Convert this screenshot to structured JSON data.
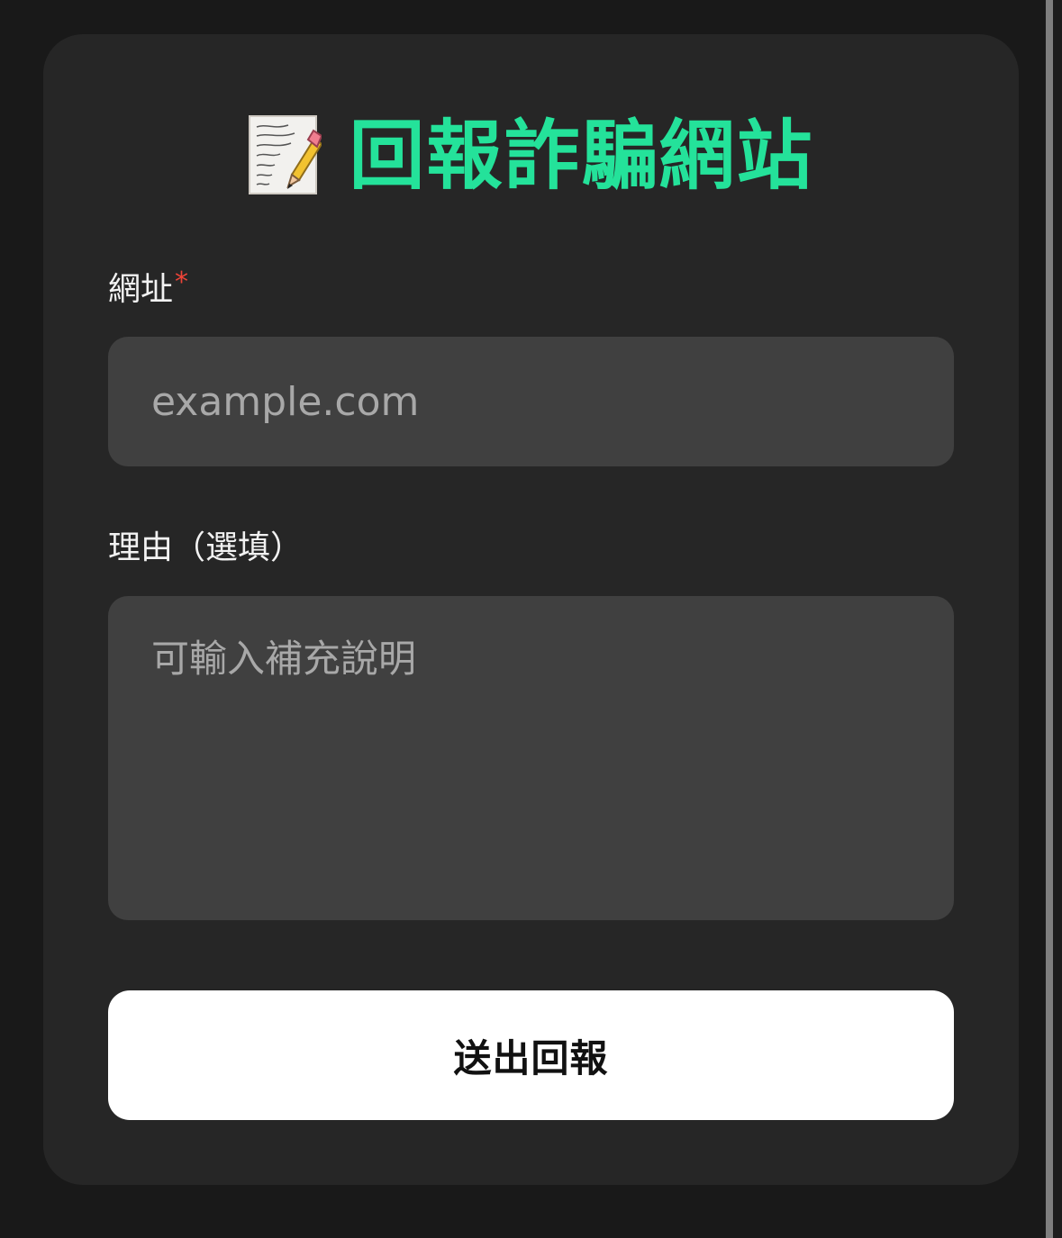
{
  "form": {
    "title": "回報詐騙網站",
    "title_icon": "memo-icon",
    "url_label": "網址",
    "required_mark": "*",
    "url_placeholder": "example.com",
    "url_value": "",
    "reason_label": "理由（選填）",
    "reason_placeholder": "可輸入補充說明",
    "reason_value": "",
    "submit_label": "送出回報"
  },
  "colors": {
    "page_background": "#191919",
    "card_background": "#262626",
    "title_accent": "#24e29a",
    "input_background": "#404040",
    "required_mark": "#f04438",
    "button_background": "#ffffff",
    "button_text": "#111111"
  }
}
